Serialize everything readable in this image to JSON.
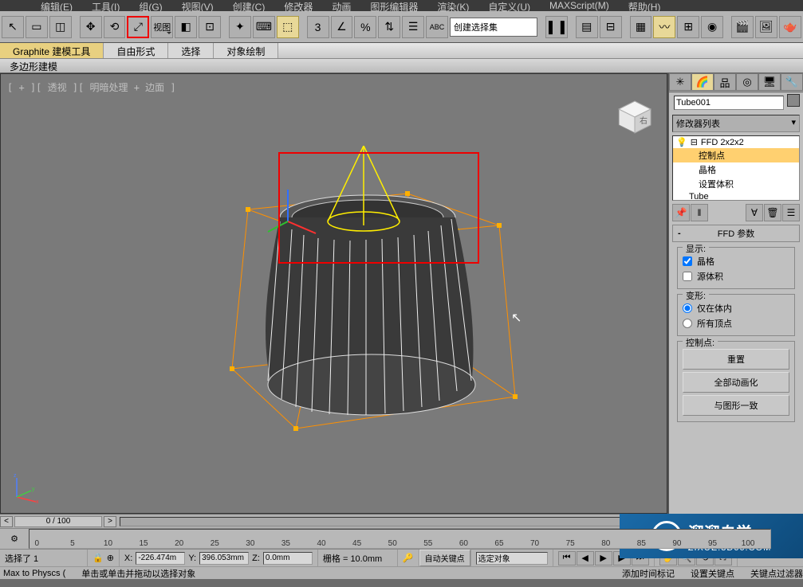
{
  "menu": {
    "items": [
      "编辑(E)",
      "工具(I)",
      "组(G)",
      "视图(V)",
      "创建(C)",
      "修改器",
      "动画",
      "图形编辑器",
      "渲染(K)",
      "自定义(U)",
      "MAXScript(M)",
      "帮助(H)"
    ]
  },
  "selection_set_label": "创建选择集",
  "ribbon": {
    "tabs": [
      "Graphite 建模工具",
      "自由形式",
      "选择",
      "对象绘制"
    ],
    "sub": "多边形建模"
  },
  "viewport": {
    "label": "[ + ][ 透视 ][ 明暗处理 + 边面 ]",
    "cube_face": "右"
  },
  "cmd": {
    "object_name": "Tube001",
    "mod_list_label": "修改器列表",
    "stack": {
      "ffd": "FFD 2x2x2",
      "ctrl_points": "控制点",
      "lattice": "晶格",
      "set_volume": "设置体积",
      "base": "Tube"
    },
    "rollup_title": "FFD 参数",
    "display_grp": "显示:",
    "lattice_chk": "晶格",
    "src_volume_chk": "源体积",
    "deform_grp": "变形:",
    "in_volume": "仅在体内",
    "all_verts": "所有顶点",
    "ctrl_grp": "控制点:",
    "reset_btn": "重置",
    "animate_all_btn": "全部动画化",
    "conform_btn": "与图形一致"
  },
  "timeline": {
    "pos": "0 / 100",
    "ticks": [
      "0",
      "5",
      "10",
      "15",
      "20",
      "25",
      "30",
      "35",
      "40",
      "45",
      "50",
      "55",
      "60",
      "65",
      "70",
      "75",
      "80",
      "85",
      "90",
      "95",
      "100"
    ]
  },
  "status": {
    "selected": "选择了 1",
    "x_label": "X:",
    "y_label": "Y:",
    "z_label": "Z:",
    "x": "-226.474m",
    "y": "396.053mm",
    "z": "0.0mm",
    "grid_label": "栅格 = 10.0mm",
    "auto_key": "自动关键点",
    "sel_obj": "选定对象",
    "set_key": "设置关键点",
    "key_filter": "关键点过滤器",
    "maxscript": "Max to Physcs (",
    "hint": "单击或单击并拖动以选择对象",
    "add_time": "添加时间标记"
  },
  "watermark": {
    "brand": "溜溜自学",
    "url": "ZIXUE.3D66.COM"
  }
}
